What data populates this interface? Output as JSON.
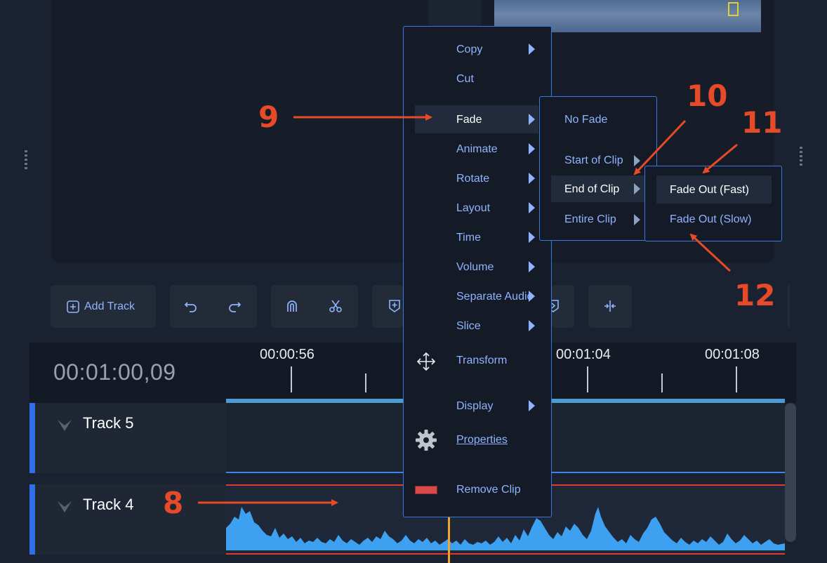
{
  "toolbar": {
    "add_track_label": "Add Track"
  },
  "timeline": {
    "timecode": "00:01:00,09",
    "ruler_labels": [
      "00:00:56",
      "00:01:04",
      "00:01:08"
    ],
    "tracks": [
      {
        "name": "Track 5"
      },
      {
        "name": "Track 4"
      }
    ]
  },
  "context_menu": {
    "items": {
      "copy": "Copy",
      "cut": "Cut",
      "fade": "Fade",
      "animate": "Animate",
      "rotate": "Rotate",
      "layout": "Layout",
      "time": "Time",
      "volume": "Volume",
      "separate_audio": "Separate Audio",
      "slice": "Slice",
      "transform": "Transform",
      "display": "Display",
      "properties": "Properties",
      "remove_clip": "Remove Clip"
    }
  },
  "fade_submenu": {
    "no_fade": "No Fade",
    "start_of_clip": "Start of Clip",
    "end_of_clip": "End of Clip",
    "entire_clip": "Entire Clip"
  },
  "end_of_clip_submenu": {
    "fade_out_fast": "Fade Out (Fast)",
    "fade_out_slow": "Fade Out (Slow)"
  },
  "annotations": [
    "9",
    "10",
    "11",
    "12",
    "8"
  ],
  "colors": {
    "accent": "#8fb4ff",
    "menu_border": "#3a78e0",
    "annotation": "#e64a28",
    "track_accent": "#2f6fe8",
    "waveform": "#3ea0f0",
    "playhead": "#f2a52a"
  }
}
